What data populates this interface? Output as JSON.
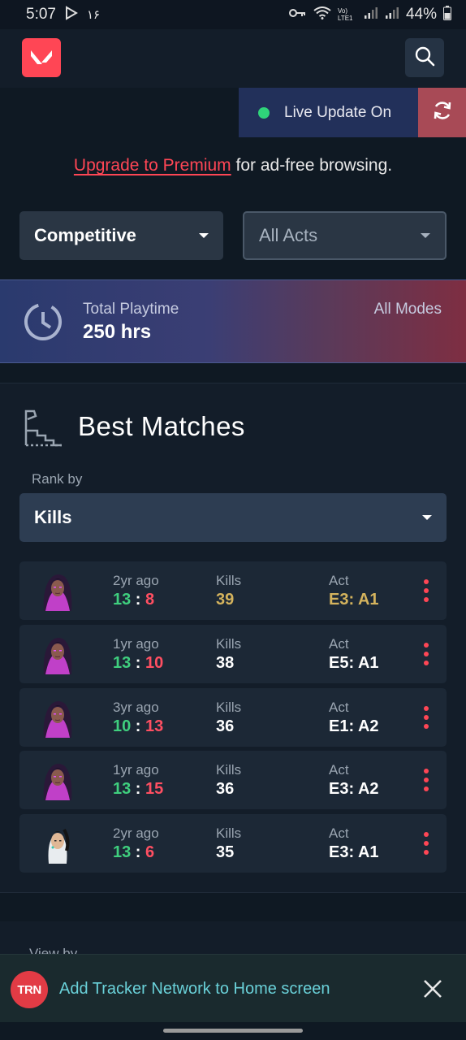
{
  "status_bar": {
    "time": "5:07",
    "date_extra": "١۶",
    "network_label": "Vo) LTE1",
    "battery": "44%"
  },
  "topbar": {
    "logo_icon": "valorant-logo-icon",
    "search_icon": "search-icon"
  },
  "live_update": {
    "label": "Live Update On",
    "status_color": "#2fd37a",
    "refresh_icon": "refresh-icon"
  },
  "premium": {
    "link": "Upgrade to Premium",
    "text": " for ad-free browsing."
  },
  "filters": {
    "mode": "Competitive",
    "acts": "All Acts"
  },
  "playtime": {
    "label": "Total Playtime",
    "value": "250 hrs",
    "scope": "All Modes"
  },
  "best_matches": {
    "title": "Best Matches",
    "rank_by_label": "Rank by",
    "rank_by_value": "Kills",
    "matches": [
      {
        "agent": "reyna",
        "ago": "2yr ago",
        "score_win": "13",
        "score_loss": "8",
        "stat_label": "Kills",
        "stat_value": "39",
        "act_label": "Act",
        "act_value": "E3: A1",
        "highlight": true
      },
      {
        "agent": "reyna",
        "ago": "1yr ago",
        "score_win": "13",
        "score_loss": "10",
        "stat_label": "Kills",
        "stat_value": "38",
        "act_label": "Act",
        "act_value": "E5: A1",
        "highlight": false
      },
      {
        "agent": "reyna",
        "ago": "3yr ago",
        "score_win": "10",
        "score_loss": "13",
        "stat_label": "Kills",
        "stat_value": "36",
        "act_label": "Act",
        "act_value": "E1: A2",
        "highlight": false
      },
      {
        "agent": "reyna",
        "ago": "1yr ago",
        "score_win": "13",
        "score_loss": "15",
        "stat_label": "Kills",
        "stat_value": "36",
        "act_label": "Act",
        "act_value": "E3: A2",
        "highlight": false
      },
      {
        "agent": "sage",
        "ago": "2yr ago",
        "score_win": "13",
        "score_loss": "6",
        "stat_label": "Kills",
        "stat_value": "35",
        "act_label": "Act",
        "act_value": "E3: A1",
        "highlight": false
      }
    ],
    "score_separator": ":"
  },
  "next_card": {
    "label": "View by"
  },
  "install_banner": {
    "logo_text": "TRN",
    "text": "Add Tracker Network to Home screen",
    "close_icon": "close-icon"
  }
}
